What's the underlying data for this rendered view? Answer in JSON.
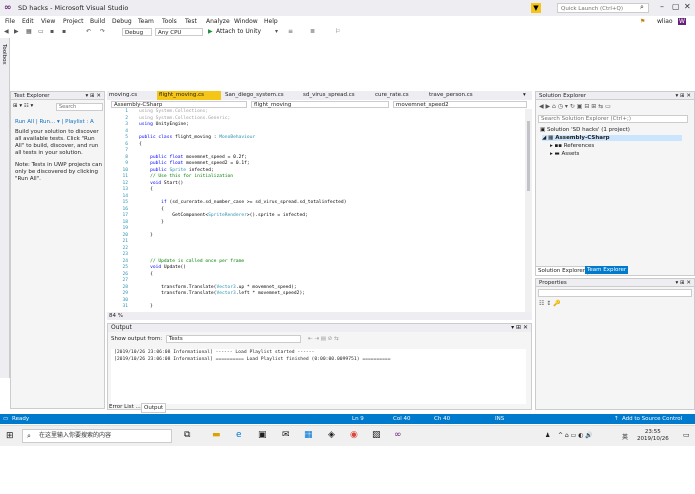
{
  "window": {
    "title": "SD hacks - Microsoft Visual Studio"
  },
  "titlebar": {
    "quick_launch_placeholder": "Quick Launch (Ctrl+Q)",
    "user": "wliao",
    "user_initial": "W"
  },
  "menu": [
    "File",
    "Edit",
    "View",
    "Project",
    "Build",
    "Debug",
    "Team",
    "Tools",
    "Test",
    "Analyze",
    "Window",
    "Help"
  ],
  "toolbar": {
    "config": "Debug",
    "platform": "Any CPU",
    "attach": "Attach to Unity"
  },
  "toolbox_label": "Toolbox",
  "test_explorer": {
    "title": "Test Explorer",
    "search_placeholder": "Search",
    "links": [
      "Run All",
      "Run...",
      "Playlist : A"
    ],
    "message1": "Build your solution to discover all available tests. Click \"Run All\" to build, discover, and run all tests in your solution.",
    "message2": "Note: Tests in UWP projects can only be discovered by clicking \"Run All\"."
  },
  "editor": {
    "tabs": [
      "moving.cs",
      "flight_moving.cs",
      "San_diego_system.cs",
      "sd_virus_spread.cs",
      "cure_rate.cs",
      "trave_person.cs"
    ],
    "nav": {
      "project": "Assembly-CSharp",
      "class": "flight_moving",
      "member": "movemnet_speed2"
    },
    "zoom": "84 %",
    "lines": [
      {
        "n": "1",
        "t": "using System.Collections;",
        "c": "gr"
      },
      {
        "n": "2",
        "t": "using System.Collections.Generic;",
        "c": "gr"
      },
      {
        "n": "3",
        "t": "using UnityEngine;",
        "c": ""
      },
      {
        "n": "4",
        "t": "",
        "c": ""
      },
      {
        "n": "5",
        "t": "public class flight_moving : MonoBehaviour",
        "c": ""
      },
      {
        "n": "6",
        "t": "{",
        "c": ""
      },
      {
        "n": "7",
        "t": "",
        "c": ""
      },
      {
        "n": "8",
        "t": "    public float movemnet_speed = 0.2f;",
        "c": ""
      },
      {
        "n": "9",
        "t": "    public float movemnet_speed2 = 0.1f;",
        "c": ""
      },
      {
        "n": "10",
        "t": "    public Sprite infected;",
        "c": ""
      },
      {
        "n": "11",
        "t": "    // Use this for initialization",
        "c": "cm"
      },
      {
        "n": "12",
        "t": "    void Start()",
        "c": ""
      },
      {
        "n": "13",
        "t": "    {",
        "c": ""
      },
      {
        "n": "14",
        "t": "",
        "c": ""
      },
      {
        "n": "15",
        "t": "        if (sd_curerate.sd_number_case >= sd_virus_spread.sd_totalinfected)",
        "c": ""
      },
      {
        "n": "16",
        "t": "        {",
        "c": ""
      },
      {
        "n": "17",
        "t": "            GetComponent<SpriteRenderer>().sprite = infected;",
        "c": ""
      },
      {
        "n": "18",
        "t": "        }",
        "c": ""
      },
      {
        "n": "19",
        "t": "",
        "c": ""
      },
      {
        "n": "20",
        "t": "    }",
        "c": ""
      },
      {
        "n": "21",
        "t": "",
        "c": ""
      },
      {
        "n": "22",
        "t": "",
        "c": ""
      },
      {
        "n": "23",
        "t": "",
        "c": ""
      },
      {
        "n": "24",
        "t": "    // Update is called once per frame",
        "c": "cm"
      },
      {
        "n": "25",
        "t": "    void Update()",
        "c": ""
      },
      {
        "n": "26",
        "t": "    {",
        "c": ""
      },
      {
        "n": "27",
        "t": "",
        "c": ""
      },
      {
        "n": "28",
        "t": "        transform.Translate(Vector3.up * movemnet_speed);",
        "c": ""
      },
      {
        "n": "29",
        "t": "        transform.Translate(Vector3.left * movemnet_speed2);",
        "c": ""
      },
      {
        "n": "30",
        "t": "",
        "c": ""
      },
      {
        "n": "31",
        "t": "    }",
        "c": ""
      }
    ]
  },
  "output": {
    "title": "Output",
    "show_from_label": "Show output from:",
    "source": "Tests",
    "lines": [
      "[2019/10/26 23:06:08 Informational] ------ Load Playlist started ------",
      "[2019/10/26 23:06:08 Informational] ========== Load Playlist finished (0:00:00.0099751) =========="
    ],
    "bottom_tabs": [
      "Error List ...",
      "Output"
    ]
  },
  "solution_explorer": {
    "title": "Solution Explorer",
    "search_placeholder": "Search Solution Explorer (Ctrl+;)",
    "solution": "Solution 'SD hacks' (1 project)",
    "project": "Assembly-CSharp",
    "children": [
      "References",
      "Assets"
    ],
    "tabs": [
      "Solution Explorer",
      "Team Explorer"
    ]
  },
  "properties": {
    "title": "Properties"
  },
  "status": {
    "ready": "Ready",
    "ln": "Ln 9",
    "col": "Col 40",
    "ch": "Ch 40",
    "ins": "INS",
    "source_control": "Add to Source Control"
  },
  "taskbar": {
    "search_placeholder": "在这里输入你要搜索的内容",
    "time": "23:55",
    "date": "2019/10/26",
    "ime": "英"
  },
  "colors": {
    "accent": "#007acc",
    "active_tab": "#f5c518",
    "keyword": "#0000ff",
    "type": "#2b91af",
    "comment": "#008000"
  }
}
